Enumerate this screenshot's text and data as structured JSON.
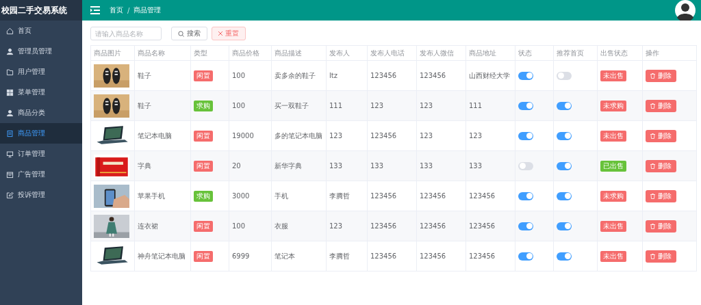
{
  "sidebar": {
    "title": "校园二手交易系统",
    "items": [
      {
        "label": "首页",
        "selected": false
      },
      {
        "label": "管理员管理",
        "selected": false
      },
      {
        "label": "用户管理",
        "selected": false
      },
      {
        "label": "菜单管理",
        "selected": false
      },
      {
        "label": "商品分类",
        "selected": false
      },
      {
        "label": "商品管理",
        "selected": true
      },
      {
        "label": "订单管理",
        "selected": false
      },
      {
        "label": "广告管理",
        "selected": false
      },
      {
        "label": "投诉管理",
        "selected": false
      }
    ]
  },
  "topbar": {
    "breadcrumb": [
      "首页",
      "商品管理"
    ],
    "separator": "/"
  },
  "search": {
    "placeholder": "请输入商品名称",
    "search_button": "搜索",
    "reset_button": "重置"
  },
  "table": {
    "columns": [
      "商品图片",
      "商品名称",
      "类型",
      "商品价格",
      "商品描述",
      "发布人",
      "发布人电话",
      "发布人微信",
      "商品地址",
      "状态",
      "推荐首页",
      "出售状态",
      "操作"
    ],
    "rows": [
      {
        "name": "鞋子",
        "type": {
          "text": "闲置",
          "color": "#f56c6c"
        },
        "price": "100",
        "description": "卖多余的鞋子",
        "publisher": "ltz",
        "phone": "123456",
        "wechat": "123456",
        "address": "山西财经大学",
        "status": true,
        "recommended": false,
        "sale_status": {
          "text": "未出售",
          "color": "#f56c6c"
        },
        "action": "删除"
      },
      {
        "name": "鞋子",
        "type": {
          "text": "求购",
          "color": "#67c23a"
        },
        "price": "100",
        "description": "买一双鞋子",
        "publisher": "111",
        "phone": "123",
        "wechat": "123",
        "address": "111",
        "status": true,
        "recommended": true,
        "sale_status": {
          "text": "未求购",
          "color": "#f56c6c"
        },
        "action": "删除"
      },
      {
        "name": "笔记本电脑",
        "type": {
          "text": "闲置",
          "color": "#f56c6c"
        },
        "price": "19000",
        "description": "多的笔记本电脑",
        "publisher": "123",
        "phone": "123456",
        "wechat": "123",
        "address": "123",
        "status": true,
        "recommended": true,
        "sale_status": {
          "text": "未出售",
          "color": "#f56c6c"
        },
        "action": "删除"
      },
      {
        "name": "字典",
        "type": {
          "text": "闲置",
          "color": "#f56c6c"
        },
        "price": "20",
        "description": "新华字典",
        "publisher": "133",
        "phone": "133",
        "wechat": "133",
        "address": "133",
        "status": false,
        "recommended": true,
        "sale_status": {
          "text": "已出售",
          "color": "#67c23a"
        },
        "action": "删除"
      },
      {
        "name": "苹果手机",
        "type": {
          "text": "求购",
          "color": "#67c23a"
        },
        "price": "3000",
        "description": "手机",
        "publisher": "李腾哲",
        "phone": "123456",
        "wechat": "123456",
        "address": "123456",
        "status": true,
        "recommended": true,
        "sale_status": {
          "text": "未求购",
          "color": "#f56c6c"
        },
        "action": "删除"
      },
      {
        "name": "连衣裙",
        "type": {
          "text": "闲置",
          "color": "#f56c6c"
        },
        "price": "100",
        "description": "衣服",
        "publisher": "123",
        "phone": "123456",
        "wechat": "123456",
        "address": "123456",
        "status": true,
        "recommended": true,
        "sale_status": {
          "text": "未出售",
          "color": "#f56c6c"
        },
        "action": "删除"
      },
      {
        "name": "神舟笔记本电脑",
        "type": {
          "text": "闲置",
          "color": "#f56c6c"
        },
        "price": "6999",
        "description": "笔记本",
        "publisher": "李腾哲",
        "phone": "123456",
        "wechat": "123456",
        "address": "123456",
        "status": true,
        "recommended": true,
        "sale_status": {
          "text": "未出售",
          "color": "#f56c6c"
        },
        "action": "删除"
      }
    ]
  }
}
